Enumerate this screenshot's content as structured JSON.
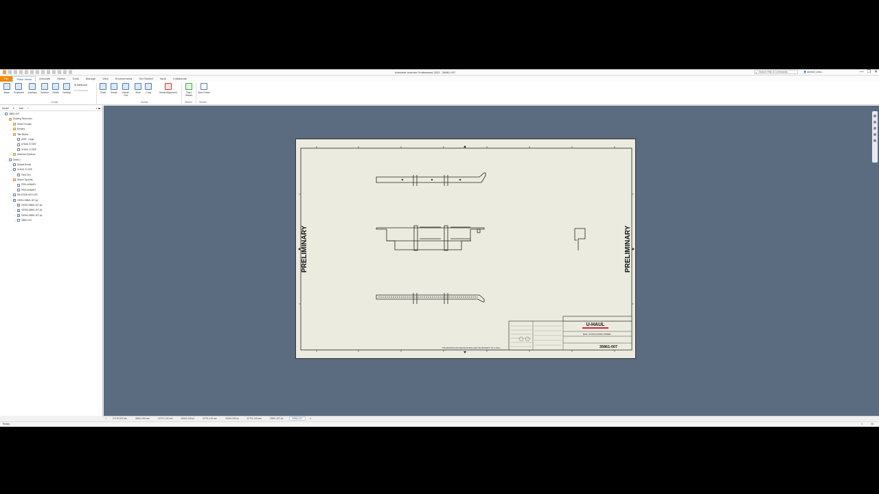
{
  "window": {
    "title": "Autodesk Inventor Professional 2023 - 35861-007",
    "search_placeholder": "Search Help & Commands...",
    "user": "andrew_voss...",
    "controls": [
      "—",
      "❐",
      "✕"
    ]
  },
  "ribbon": {
    "tabs": [
      "File",
      "Place Views",
      "Annotate",
      "Sketch",
      "Tools",
      "Manage",
      "View",
      "Environments",
      "Get Started",
      "Vault",
      "Collaborate"
    ],
    "create": {
      "label": "Create",
      "buttons": [
        "Base",
        "Projected",
        "Auxiliary",
        "Section",
        "Detail",
        "Overlay"
      ],
      "small": [
        "Nailboard",
        "Connector"
      ]
    },
    "modify": {
      "label": "Modify",
      "buttons": [
        "Draft",
        "Break",
        "Break Out",
        "Slice",
        "Crop",
        "Break Alignment"
      ]
    },
    "sketch": {
      "label": "Sketch",
      "buttons": [
        "Start Sketch"
      ]
    },
    "sheets": {
      "label": "Sheets",
      "buttons": [
        "New Sheet"
      ]
    }
  },
  "browser": {
    "tabs": [
      "Model",
      "Add"
    ],
    "tree": [
      {
        "label": "35861-007",
        "depth": 0,
        "icon": "sheet",
        "exp": "−"
      },
      {
        "label": "Drawing Resources",
        "depth": 1,
        "icon": "folder",
        "exp": "−"
      },
      {
        "label": "Sheet Formats",
        "depth": 2,
        "icon": "folder",
        "exp": ""
      },
      {
        "label": "Borders",
        "depth": 2,
        "icon": "folder",
        "exp": "+"
      },
      {
        "label": "Title Blocks",
        "depth": 2,
        "icon": "folder",
        "exp": "−"
      },
      {
        "label": "ANSI - Large",
        "depth": 3,
        "icon": "sheet",
        "exp": ""
      },
      {
        "label": "UHAUL B SIZE",
        "depth": 3,
        "icon": "sheet",
        "exp": ""
      },
      {
        "label": "UHAUL D SIZE",
        "depth": 3,
        "icon": "sheet",
        "exp": ""
      },
      {
        "label": "Sketched Symbols",
        "depth": 2,
        "icon": "folder",
        "exp": "+"
      },
      {
        "label": "Sheet:1",
        "depth": 1,
        "icon": "sheet",
        "exp": "−"
      },
      {
        "label": "Default Border",
        "depth": 2,
        "icon": "sheet",
        "exp": ""
      },
      {
        "label": "UHAUL D SIZE",
        "depth": 2,
        "icon": "sheet",
        "exp": "−"
      },
      {
        "label": "Field Text",
        "depth": 3,
        "icon": "sheet",
        "exp": ""
      },
      {
        "label": "Sketch Symbols",
        "depth": 2,
        "icon": "folder",
        "exp": "−"
      },
      {
        "label": "PRELIMINARY",
        "depth": 3,
        "icon": "sheet",
        "exp": ""
      },
      {
        "label": "PRELIMINARY",
        "depth": 3,
        "icon": "sheet",
        "exp": ""
      },
      {
        "label": "REVISION HISTORY",
        "depth": 2,
        "icon": "sheet",
        "exp": ""
      },
      {
        "label": "VIEW1:35861-007.ipt",
        "depth": 2,
        "icon": "view",
        "exp": "−"
      },
      {
        "label": "VIEW2:35861-007.ipt",
        "depth": 3,
        "icon": "view",
        "exp": "+"
      },
      {
        "label": "VIEW3:35861-007.ipt",
        "depth": 3,
        "icon": "view",
        "exp": "+"
      },
      {
        "label": "VIEW4:35861-007.ipt",
        "depth": 3,
        "icon": "view",
        "exp": "+"
      },
      {
        "label": "35861-007",
        "depth": 3,
        "icon": "sheet",
        "exp": "+"
      }
    ]
  },
  "sheet": {
    "watermark": "PRELIMINARY",
    "brand": "U-HAUL",
    "part_title": "RAIL, 12 RCK DOOR LOWER",
    "part_number": "35861-007",
    "footer_note": "THIS DRAWING AND SPECIFICATIONS ARE THE PROPERTY OF U-HAUL"
  },
  "doc_tabs": [
    "37178-003.idw",
    "35861-006.iam",
    "42791-142.iam",
    "35861-008.ipt",
    "42791-140.iam",
    "35448-006.ipt",
    "42791-135.iam",
    "35861-007.ipt",
    "35861-007"
  ],
  "status": {
    "left": "Ready",
    "right": [
      "1",
      "24"
    ]
  }
}
